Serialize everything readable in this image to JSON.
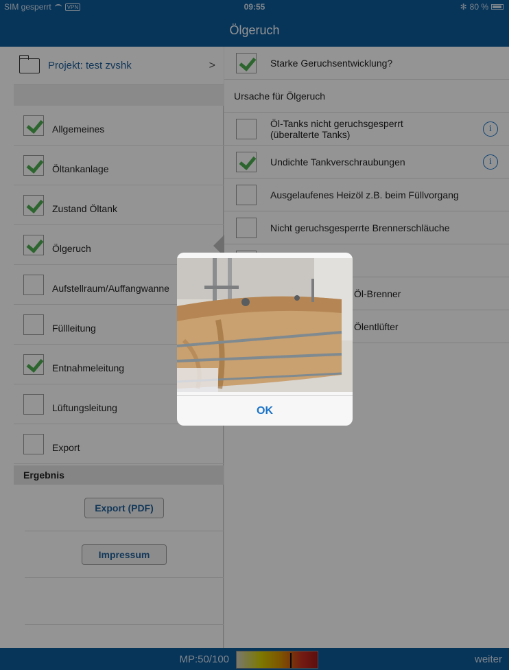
{
  "status": {
    "carrier": "SIM gesperrt",
    "vpn": "VPN",
    "time": "09:55",
    "battery": "80 %",
    "battery_level": 80
  },
  "title": "Ölgeruch",
  "sidebar": {
    "project": "Projekt: test zvshk",
    "items": [
      {
        "label": "Allgemeines",
        "checked": true
      },
      {
        "label": "Öltankanlage",
        "checked": true
      },
      {
        "label": "Zustand Öltank",
        "checked": true
      },
      {
        "label": "Ölgeruch",
        "checked": true
      },
      {
        "label": "Aufstellraum/Auffangwanne",
        "checked": false
      },
      {
        "label": "Füllleitung",
        "checked": false
      },
      {
        "label": "Entnahmeleitung",
        "checked": true
      },
      {
        "label": "Lüftungsleitung",
        "checked": false
      },
      {
        "label": "Export",
        "checked": false
      }
    ],
    "result_heading": "Ergebnis",
    "export_button": "Export (PDF)",
    "impressum_button": "Impressum"
  },
  "content": {
    "top_question": "Starke Geruchsentwicklung?",
    "cause_heading": "Ursache für Ölgeruch",
    "causes": [
      {
        "line1": "Öl-Tanks nicht geruchsgesperrt",
        "line2": "(überalterte Tanks)",
        "checked": false,
        "info": true
      },
      {
        "line1": "Undichte Tankverschraubungen",
        "line2": "",
        "checked": true,
        "info": true
      },
      {
        "line1": "Ausgelaufenes Heizöl z.B. beim Füllvorgang",
        "line2": "",
        "checked": false,
        "info": false
      },
      {
        "line1": "Nicht geruchsgesperrte Brennerschläuche",
        "line2": "",
        "checked": false,
        "info": false
      },
      {
        "line1": "",
        "line2": "",
        "checked": false,
        "info": false
      },
      {
        "line1": "Öl-Brenner",
        "line2": "",
        "checked": false,
        "info": false
      },
      {
        "line1": "Ölentlüfter",
        "line2": "",
        "checked": false,
        "info": false
      }
    ]
  },
  "bottom": {
    "mp": "MP:50/100",
    "mp_fraction": 0.5,
    "next": "weiter"
  },
  "alert": {
    "ok": "OK"
  },
  "colors": {
    "bar": "#0d5a9a",
    "link": "#1f5f99",
    "check": "#4caf50",
    "ios_blue": "#1a73c8"
  },
  "icons": [
    "folder-icon",
    "chevron-right-icon",
    "check-icon",
    "info-icon",
    "wifi-icon",
    "battery-icon",
    "bluetooth-icon"
  ]
}
